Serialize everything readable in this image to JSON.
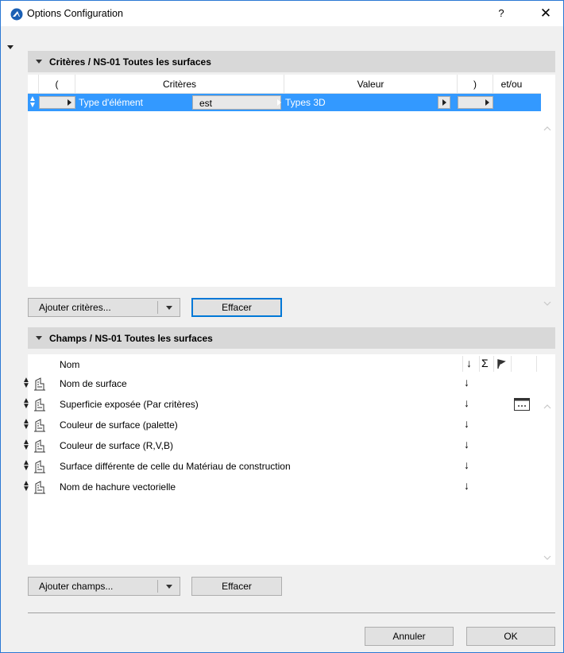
{
  "window": {
    "title": "Options Configuration",
    "help_label": "?",
    "close_label": "✕"
  },
  "criteria": {
    "header": "Critères / NS-01 Toutes les surfaces",
    "columns": [
      "(",
      "Critères",
      "Valeur",
      ")",
      "et/ou"
    ],
    "row": {
      "type": "Type d'élément",
      "operator": "est",
      "value": "Types 3D"
    },
    "add_label": "Ajouter critères...",
    "clear_label": "Effacer"
  },
  "fields": {
    "header": "Champs / NS-01 Toutes les surfaces",
    "name_col": "Nom",
    "sort_icon": "↓",
    "sum_icon": "Σ",
    "items": [
      {
        "name": "Nom de surface"
      },
      {
        "name": "Superficie exposée (Par critères)"
      },
      {
        "name": "Couleur de surface (palette)"
      },
      {
        "name": "Couleur de surface (R,V,B)"
      },
      {
        "name": "Surface différente de celle du Matériau de construction"
      },
      {
        "name": "Nom de hachure vectorielle"
      }
    ],
    "add_label": "Ajouter champs...",
    "clear_label": "Effacer"
  },
  "footer": {
    "cancel_label": "Annuler",
    "ok_label": "OK"
  },
  "colors": {
    "selection": "#3399ff",
    "section_header": "#d8d8d8",
    "accent": "#0078d7"
  }
}
